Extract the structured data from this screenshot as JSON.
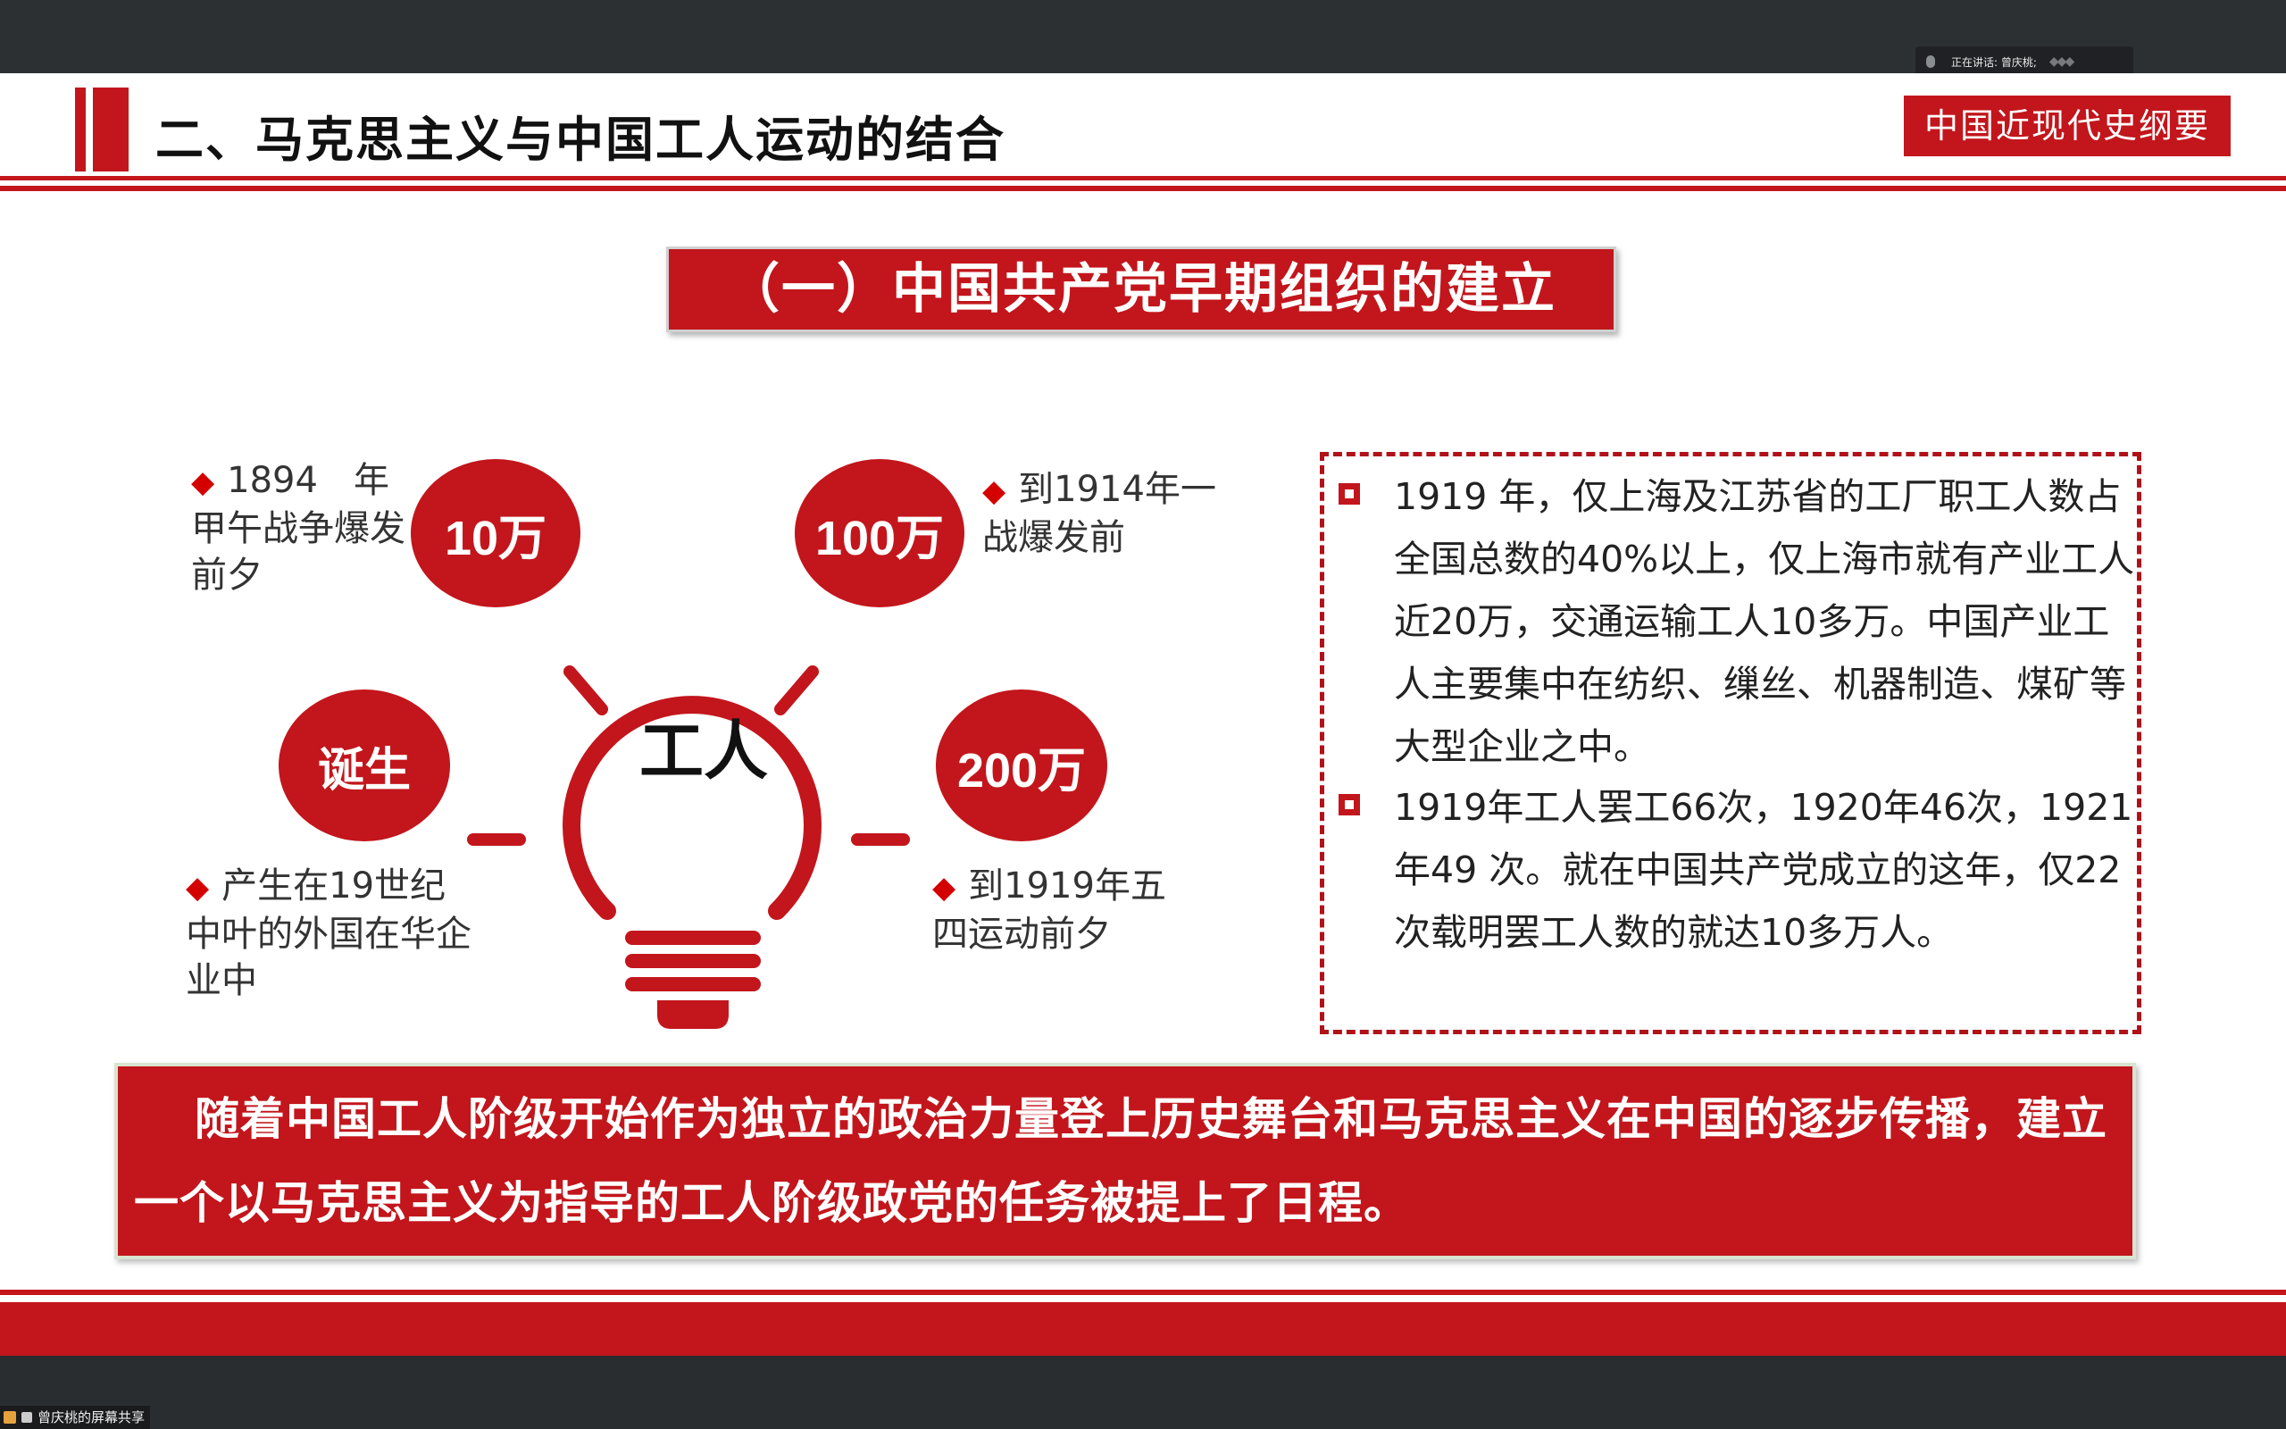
{
  "meeting": {
    "speaking_label": "正在讲话: 曾庆桃;",
    "share_label": "曾庆桃的屏幕共享"
  },
  "slide": {
    "section_title": "二、马克思主义与中国工人运动的结合",
    "course_name": "中国近现代史纲要",
    "subtitle": "（一）中国共产党早期组织的建立",
    "diagram": {
      "center": "工人",
      "circles": [
        "10万",
        "100万",
        "诞生",
        "200万"
      ],
      "annotations": [
        "1894　年甲午战争爆发前夕",
        "到1914年一战爆发前",
        "产生在19世纪中叶的外国在华企业中",
        "到1919年五四运动前夕"
      ]
    },
    "facts": [
      "1919 年，仅上海及江苏省的工厂职工人数占全国总数的40%以上，仅上海市就有产业工人近20万，交通运输工人10多万。中国产业工人主要集中在纺织、缫丝、机器制造、煤矿等大型企业之中。",
      "1919年工人罢工66次，1920年46次，1921年49 次。就在中国共产党成立的这年，仅22次载明罢工人数的就达10多万人。"
    ],
    "conclusion": "随着中国工人阶级开始作为独立的政治力量登上历史舞台和马克思主义在中国的逐步传播，建立一个以马克思主义为指导的工人阶级政党的任务被提上了日程。"
  },
  "colors": {
    "accent": "#c2161c",
    "diamond": "#d40000"
  }
}
